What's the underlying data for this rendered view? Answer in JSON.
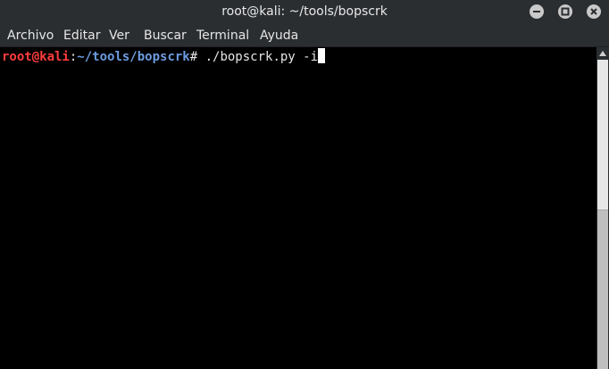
{
  "window": {
    "title": "root@kali: ~/tools/bopscrk",
    "controls": {
      "minimize": "minimize-icon",
      "maximize": "maximize-icon",
      "close": "close-icon"
    }
  },
  "menu": {
    "items": [
      "Archivo",
      "Editar",
      "Ver",
      "Buscar",
      "Terminal",
      "Ayuda"
    ]
  },
  "terminal": {
    "prompt_user": "root@kali",
    "prompt_colon": ":",
    "prompt_path": "~/tools/bopscrk",
    "prompt_symbol": "# ",
    "command": "./bopscrk.py -i",
    "colors": {
      "background": "#000000",
      "user": "#ff3c3c",
      "path": "#6c9ce0",
      "text": "#e6e6e6"
    }
  }
}
